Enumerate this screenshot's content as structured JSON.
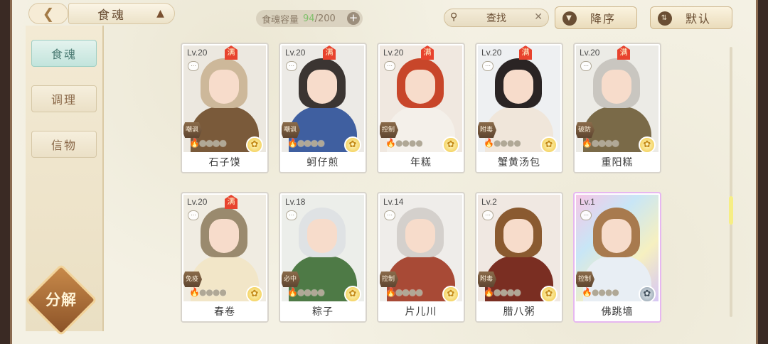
{
  "header": {
    "back_icon": "back-arrow-icon",
    "title": "食魂",
    "capacity_label": "食魂容量",
    "capacity_current": "94",
    "capacity_total": "/200",
    "plus": "+",
    "search_placeholder": "查找",
    "sort_order": "降序",
    "sort_mode": "默认"
  },
  "sidebar": {
    "tabs": [
      {
        "label": "食魂"
      },
      {
        "label": "调理"
      },
      {
        "label": "信物"
      }
    ],
    "decompose_label": "分解"
  },
  "colors": {
    "accent_teal": "#c2e4dc",
    "badge_red": "#e8432e",
    "seal_gold": "#f0c640"
  },
  "cards": [
    {
      "level": "Lv.20",
      "full": "满",
      "role": "嘲讽",
      "name": "石子馍",
      "hair": "#cdb89a",
      "outfit": "#7a5a3a",
      "bg": "#ece8e0",
      "seal": "gold"
    },
    {
      "level": "Lv.20",
      "full": "满",
      "role": "嘲讽",
      "name": "蚵仔煎",
      "hair": "#3b3532",
      "outfit": "#3f5fa0",
      "bg": "#eceae6",
      "seal": "gold"
    },
    {
      "level": "Lv.20",
      "full": "满",
      "role": "控制",
      "name": "年糕",
      "hair": "#c8462a",
      "outfit": "#f4f0ea",
      "bg": "#f0e8e0",
      "seal": "gold"
    },
    {
      "level": "Lv.20",
      "full": "满",
      "role": "附毒",
      "name": "蟹黄汤包",
      "hair": "#2a2424",
      "outfit": "#f0e6da",
      "bg": "#eef0f2",
      "seal": "gold"
    },
    {
      "level": "Lv.20",
      "full": "满",
      "role": "破防",
      "name": "重阳糕",
      "hair": "#c9c6c0",
      "outfit": "#7a6a48",
      "bg": "#ecebe6",
      "seal": "gold"
    },
    {
      "level": "Lv.20",
      "full": "满",
      "role": "免疫",
      "name": "春卷",
      "hair": "#9a8a6e",
      "outfit": "#f2e6c8",
      "bg": "#f0ece2",
      "seal": "gold"
    },
    {
      "level": "Lv.18",
      "full": "",
      "role": "必中",
      "name": "粽子",
      "hair": "#dfe2e4",
      "outfit": "#4e7a46",
      "bg": "#eceeea",
      "seal": "gold"
    },
    {
      "level": "Lv.14",
      "full": "",
      "role": "控制",
      "name": "片儿川",
      "hair": "#d4d0cc",
      "outfit": "#a84a36",
      "bg": "#efedea",
      "seal": "gold"
    },
    {
      "level": "Lv.2",
      "full": "",
      "role": "附毒",
      "name": "腊八粥",
      "hair": "#8a5a30",
      "outfit": "#7a2e22",
      "bg": "#f0e8e2",
      "seal": "gold"
    },
    {
      "level": "Lv.1",
      "full": "",
      "role": "控制",
      "name": "佛跳墙",
      "hair": "#a87a4e",
      "outfit": "#e8eef4",
      "bg": "#efe6f6",
      "seal": "gray"
    }
  ]
}
